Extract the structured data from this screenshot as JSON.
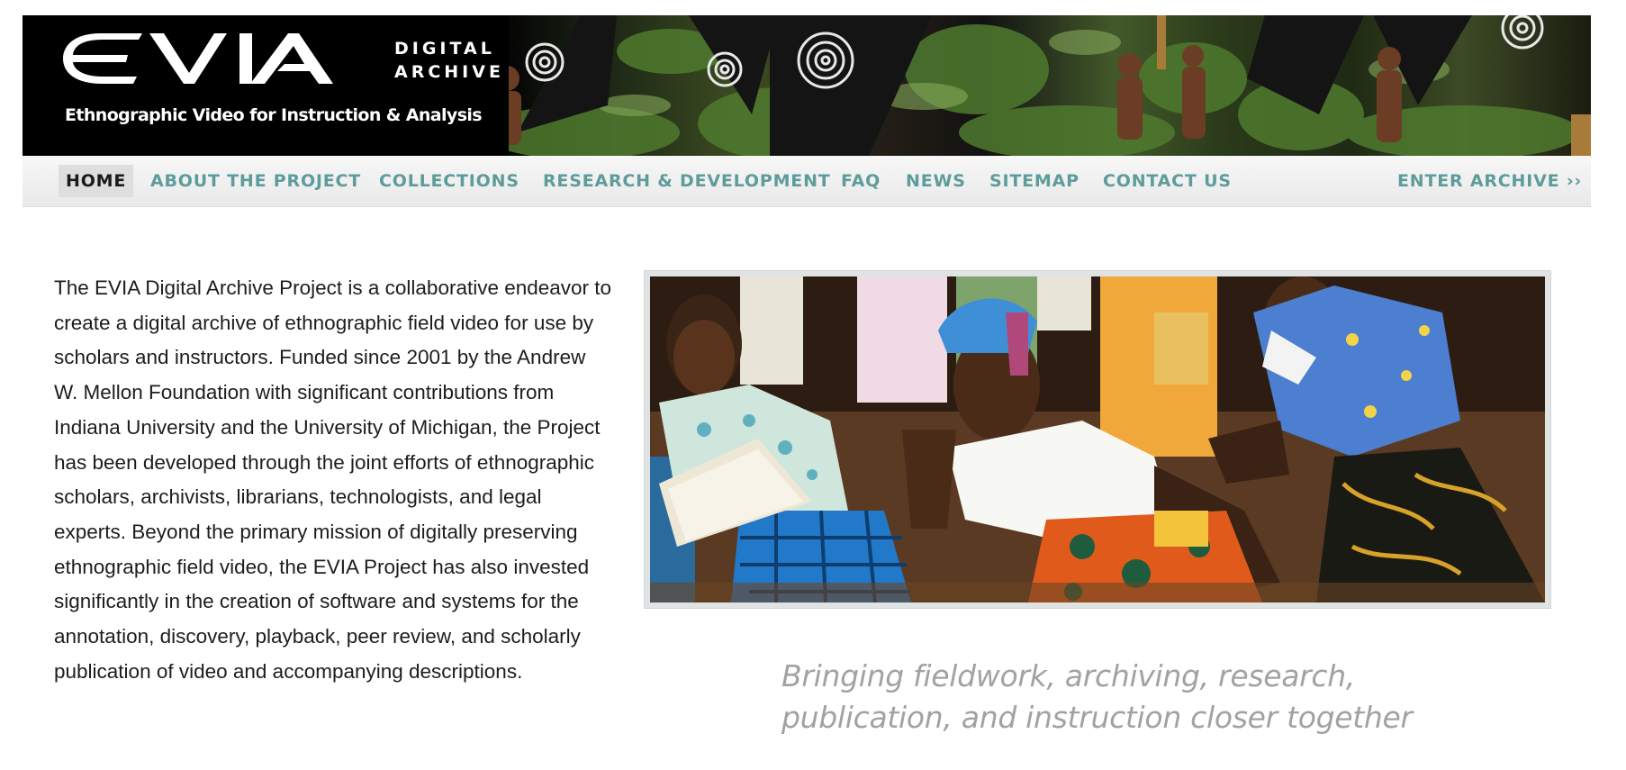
{
  "header": {
    "logo_text": "EVIA",
    "logo_line1": "DIGITAL",
    "logo_line2": "ARCHIVE",
    "tagline": "Ethnographic Video for Instruction & Analysis"
  },
  "nav": {
    "items": [
      {
        "label": "HOME",
        "active": true
      },
      {
        "label": "ABOUT THE PROJECT"
      },
      {
        "label": "COLLECTIONS"
      },
      {
        "label": "RESEARCH & DEVELOPMENT"
      },
      {
        "label": "FAQ"
      },
      {
        "label": "NEWS"
      },
      {
        "label": "SITEMAP"
      },
      {
        "label": "CONTACT US"
      }
    ],
    "enter_archive": "ENTER ARCHIVE ››"
  },
  "main": {
    "intro": "The EVIA Digital Archive Project is a collaborative endeavor to create a digital archive of ethnographic field video for use by scholars and instructors. Funded since 2001 by the Andrew W. Mellon Foundation with significant contributions from Indiana University and the University of Michigan, the Project has been developed through the joint efforts of ethnographic scholars, archivists, librarians, technologists, and legal experts. Beyond the primary mission of digitally preserving ethnographic field video, the EVIA Project has also invested significantly in the creation of software and systems for the annotation, discovery, playback, peer review, and scholarly publication of video and accompanying descriptions.",
    "caption": "Bringing fieldwork, archiving, research, publication, and instruction closer together"
  },
  "colors": {
    "nav_link": "#5e9c9c",
    "nav_active_bg": "#dedede",
    "caption": "#a2a2a2",
    "banner_bg": "#000000"
  }
}
